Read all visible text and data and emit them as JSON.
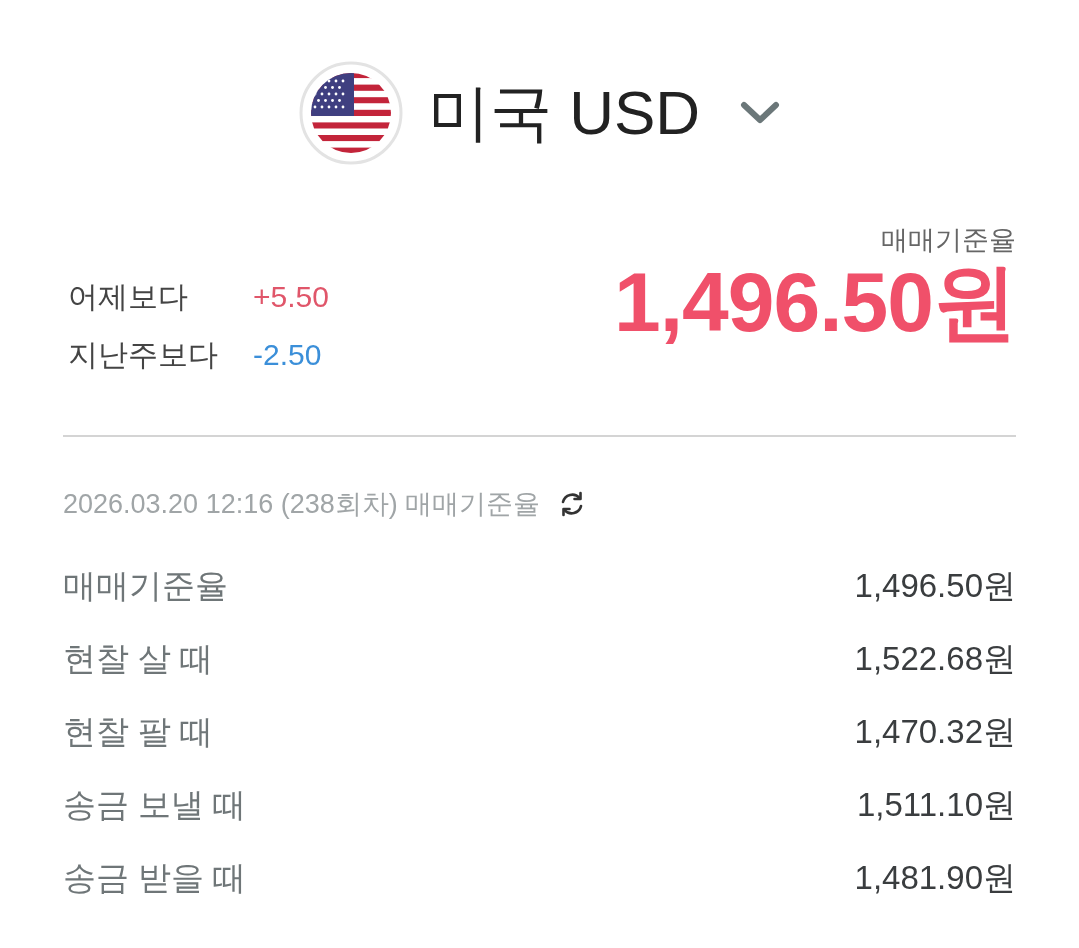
{
  "header": {
    "title": "미국 USD"
  },
  "rate": {
    "label": "매매기준율",
    "value": "1,496.50원"
  },
  "changes": [
    {
      "label": "어제보다",
      "value": "+5.50",
      "color": "#e0566a"
    },
    {
      "label": "지난주보다",
      "value": "-2.50",
      "color": "#3b8fd9"
    }
  ],
  "timestamp": "2026.03.20 12:16 (238회차) 매매기준율",
  "rates": [
    {
      "label": "매매기준율",
      "value": "1,496.50원"
    },
    {
      "label": "현찰 살 때",
      "value": "1,522.68원"
    },
    {
      "label": "현찰 팔 때",
      "value": "1,470.32원"
    },
    {
      "label": "송금 보낼 때",
      "value": "1,511.10원"
    },
    {
      "label": "송금 받을 때",
      "value": "1,481.90원"
    }
  ]
}
